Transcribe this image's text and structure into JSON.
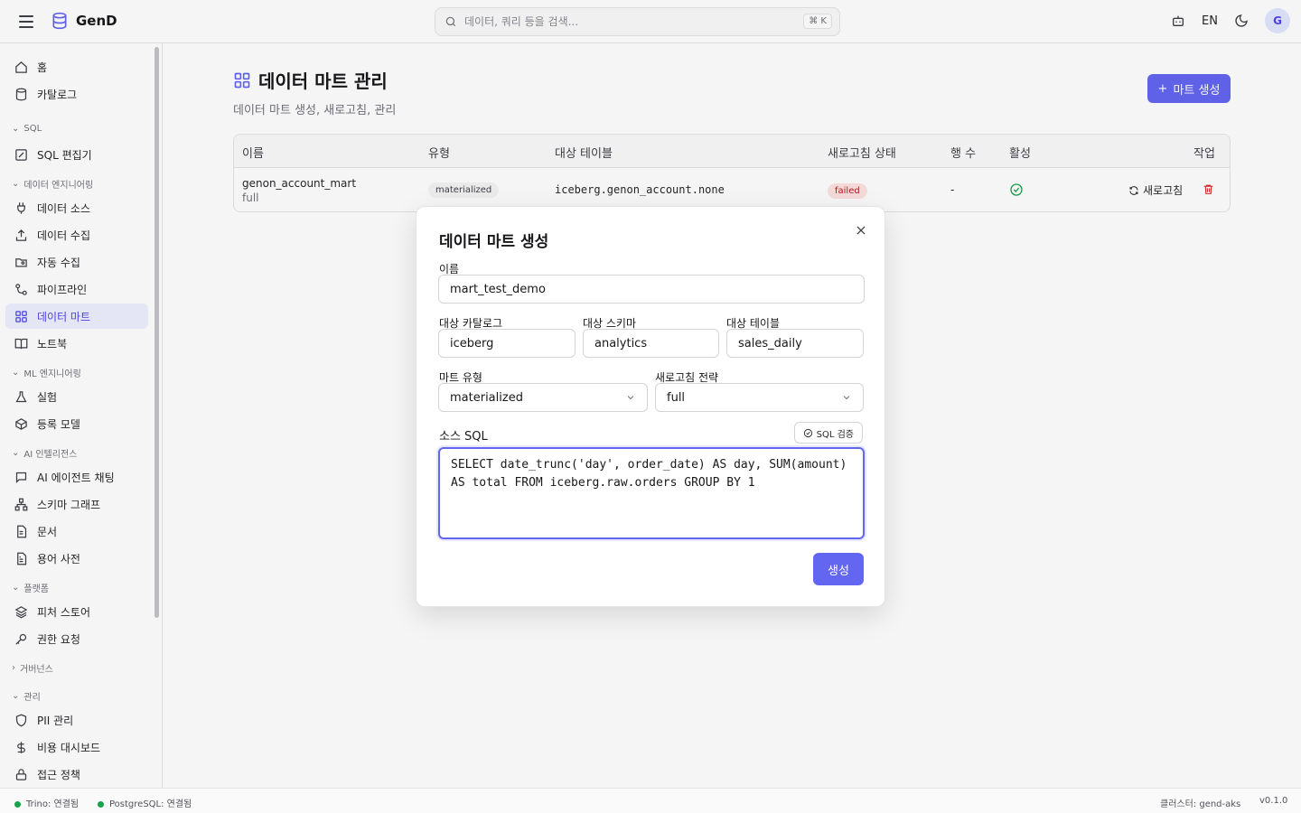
{
  "app": {
    "name": "GenD"
  },
  "search": {
    "placeholder": "데이터, 쿼리 등을 검색...",
    "shortcut": "⌘ K"
  },
  "header_right": {
    "lang": "EN",
    "avatar_initial": "G"
  },
  "sidebar": {
    "items_top": [
      "홈",
      "카탈로그"
    ],
    "sections": [
      {
        "label": "SQL",
        "items": [
          "SQL 편집기"
        ]
      },
      {
        "label": "데이터 엔지니어링",
        "items": [
          "데이터 소스",
          "데이터 수집",
          "자동 수집",
          "파이프라인",
          "데이터 마트",
          "노트북"
        ]
      },
      {
        "label": "ML 엔지니어링",
        "items": [
          "실험",
          "등록 모델"
        ]
      },
      {
        "label": "AI 인텔리전스",
        "items": [
          "AI 에이전트 채팅",
          "스키마 그래프",
          "문서",
          "용어 사전"
        ]
      },
      {
        "label": "플랫폼",
        "items": [
          "피처 스토어",
          "권한 요청"
        ]
      },
      {
        "label": "거버넌스",
        "items": []
      },
      {
        "label": "관리",
        "items": [
          "PII 관리",
          "비용 대시보드",
          "접근 정책"
        ]
      }
    ],
    "active": "데이터 마트"
  },
  "page": {
    "title": "데이터 마트 관리",
    "subtitle": "데이터 마트 생성, 새로고침, 관리",
    "create_button": "마트 생성"
  },
  "table": {
    "headers": [
      "이름",
      "유형",
      "대상 테이블",
      "새로고침 상태",
      "행 수",
      "활성",
      "작업"
    ],
    "rows": [
      {
        "name": "genon_account_mart",
        "sub": "full",
        "type": "materialized",
        "target": "iceberg.genon_account.none",
        "status": "failed",
        "rows": "-",
        "action": "새로고침"
      }
    ]
  },
  "modal": {
    "title": "데이터 마트 생성",
    "name_label": "이름",
    "name_value": "mart_test_demo",
    "catalog_label": "대상 카탈로그",
    "catalog_value": "iceberg",
    "schema_label": "대상 스키마",
    "schema_value": "analytics",
    "table_label": "대상 테이블",
    "table_value": "sales_daily",
    "type_label": "마트 유형",
    "type_value": "materialized",
    "strategy_label": "새로고침 전략",
    "strategy_value": "full",
    "sql_label": "소스 SQL",
    "sql_check": "SQL 검증",
    "sql_value": "SELECT date_trunc('day', order_date) AS day, SUM(amount) AS total FROM iceberg.raw.orders GROUP BY 1",
    "submit": "생성"
  },
  "status": {
    "trino": "Trino: 연결됨",
    "postgres": "PostgreSQL: 연결됨",
    "cluster": "클러스터: gend-aks",
    "version": "v0.1.0"
  },
  "colors": {
    "accent": "#6366f1",
    "success": "#16a34a",
    "danger": "#dc2626"
  }
}
